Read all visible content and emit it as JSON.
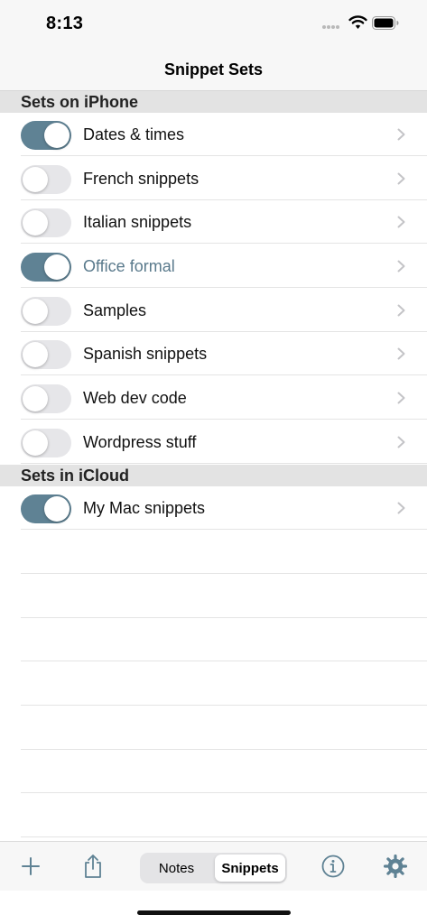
{
  "status_bar": {
    "time": "8:13"
  },
  "nav": {
    "title": "Snippet Sets"
  },
  "sections": [
    {
      "title": "Sets on iPhone",
      "rows": [
        {
          "label": "Dates & times",
          "on": true
        },
        {
          "label": "French snippets",
          "on": false
        },
        {
          "label": "Italian snippets",
          "on": false
        },
        {
          "label": "Office formal",
          "on": true,
          "highlight": true
        },
        {
          "label": "Samples",
          "on": false
        },
        {
          "label": "Spanish snippets",
          "on": false
        },
        {
          "label": "Web dev code",
          "on": false
        },
        {
          "label": "Wordpress stuff",
          "on": false
        }
      ]
    },
    {
      "title": "Sets in iCloud",
      "rows": [
        {
          "label": "My Mac snippets",
          "on": true
        }
      ]
    }
  ],
  "toolbar": {
    "segments": [
      "Notes",
      "Snippets"
    ],
    "selected_segment": "Snippets"
  },
  "colors": {
    "toggle_on": "#5f8294",
    "highlight_text": "#5a7a8c"
  }
}
